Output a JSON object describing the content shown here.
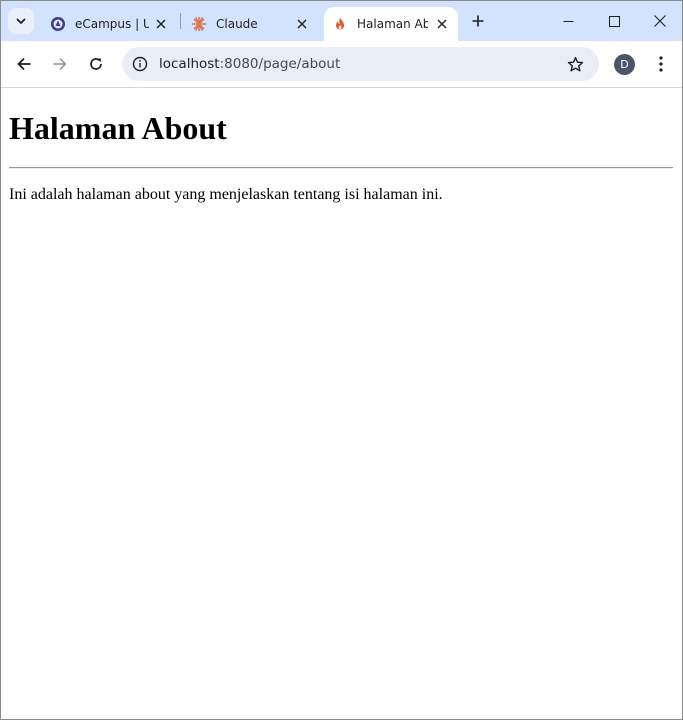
{
  "tabs": [
    {
      "title": "eCampus | UI",
      "favicon": "ecampus-logo-icon",
      "active": false
    },
    {
      "title": "Claude",
      "favicon": "claude-logo-icon",
      "active": false
    },
    {
      "title": "Halaman About",
      "favicon": "flame-icon",
      "active": true
    }
  ],
  "toolbar": {
    "url_host": "localhost",
    "url_path": ":8080/page/about",
    "profile_initial": "D"
  },
  "page": {
    "heading": "Halaman About",
    "paragraph": "Ini adalah halaman about yang menjelaskan tentang isi halaman ini."
  },
  "colors": {
    "tabstrip": "#d3e3fd",
    "omnibox": "#e9eef6",
    "avatar": "#4a5668"
  }
}
